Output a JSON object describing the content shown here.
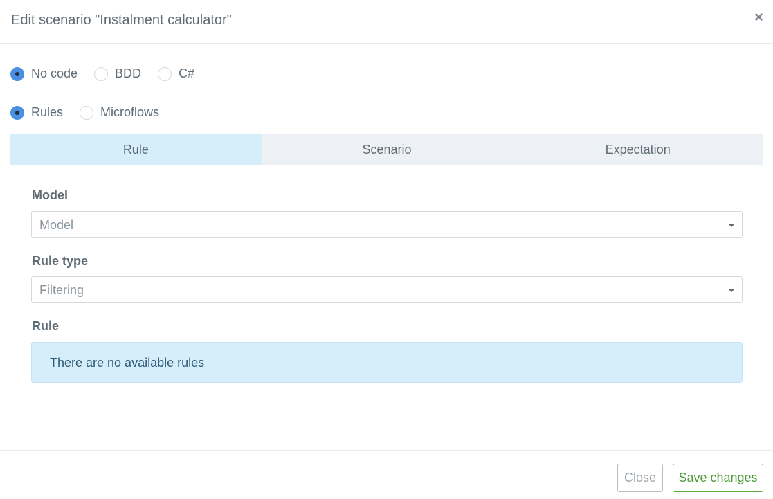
{
  "modal": {
    "title": "Edit scenario \"Instalment calculator\"",
    "close_symbol": "×"
  },
  "code_type": {
    "options": [
      "No code",
      "BDD",
      "C#"
    ],
    "selected": "No code"
  },
  "logic_type": {
    "options": [
      "Rules",
      "Microflows"
    ],
    "selected": "Rules"
  },
  "tabs": [
    {
      "label": "Rule",
      "active": true
    },
    {
      "label": "Scenario",
      "active": false
    },
    {
      "label": "Expectation",
      "active": false
    }
  ],
  "form": {
    "model_label": "Model",
    "model_value": "Model",
    "rule_type_label": "Rule type",
    "rule_type_value": "Filtering",
    "rule_label": "Rule",
    "rule_info": "There are no available rules"
  },
  "footer": {
    "close_label": "Close",
    "save_label": "Save changes"
  },
  "colors": {
    "accent": "#4a90e2",
    "tab_active": "#d6edfa",
    "save_green": "#4e9a36"
  }
}
